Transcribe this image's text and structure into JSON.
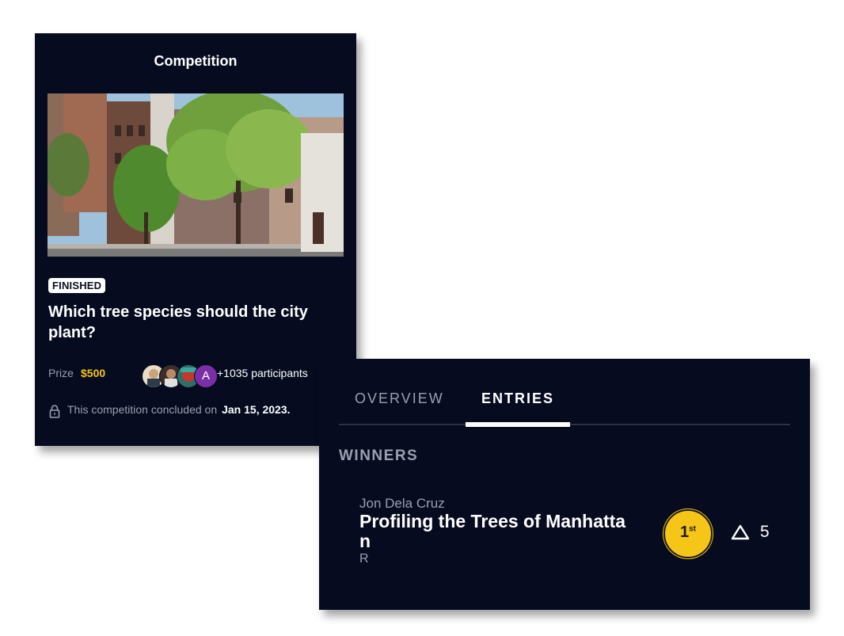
{
  "competition_card": {
    "title": "Competition",
    "status_badge": "FINISHED",
    "question": "Which tree species should the city plant?",
    "prize_label": "Prize",
    "prize_value": "$500",
    "avatars": [
      {
        "name": "participant-1",
        "color": "#d9c7a8"
      },
      {
        "name": "participant-2",
        "color": "#5a4a44"
      },
      {
        "name": "participant-3",
        "color": "#c0392b"
      },
      {
        "name": "participant-4",
        "initial": "A",
        "color": "#7b2fa6"
      }
    ],
    "participants_text": "+1035 participants",
    "concluded_text": "This competition concluded on",
    "concluded_date": "Jan 15, 2023.",
    "lock_icon": "lock-icon"
  },
  "entries_card": {
    "tabs": [
      {
        "label": "OVERVIEW",
        "active": false
      },
      {
        "label": "ENTRIES",
        "active": true
      }
    ],
    "winners_heading": "WINNERS",
    "entry": {
      "author": "Jon Dela Cruz",
      "title": "Profiling the Trees of Manhattan",
      "extra": "R",
      "rank": "1",
      "rank_suffix": "st",
      "votes": "5",
      "vote_icon": "triangle-upvote-icon"
    }
  },
  "colors": {
    "card_bg": "#060b1f",
    "accent_gold": "#f5c518",
    "muted_text": "#9aa0b0",
    "purple_avatar": "#7b2fa6"
  }
}
